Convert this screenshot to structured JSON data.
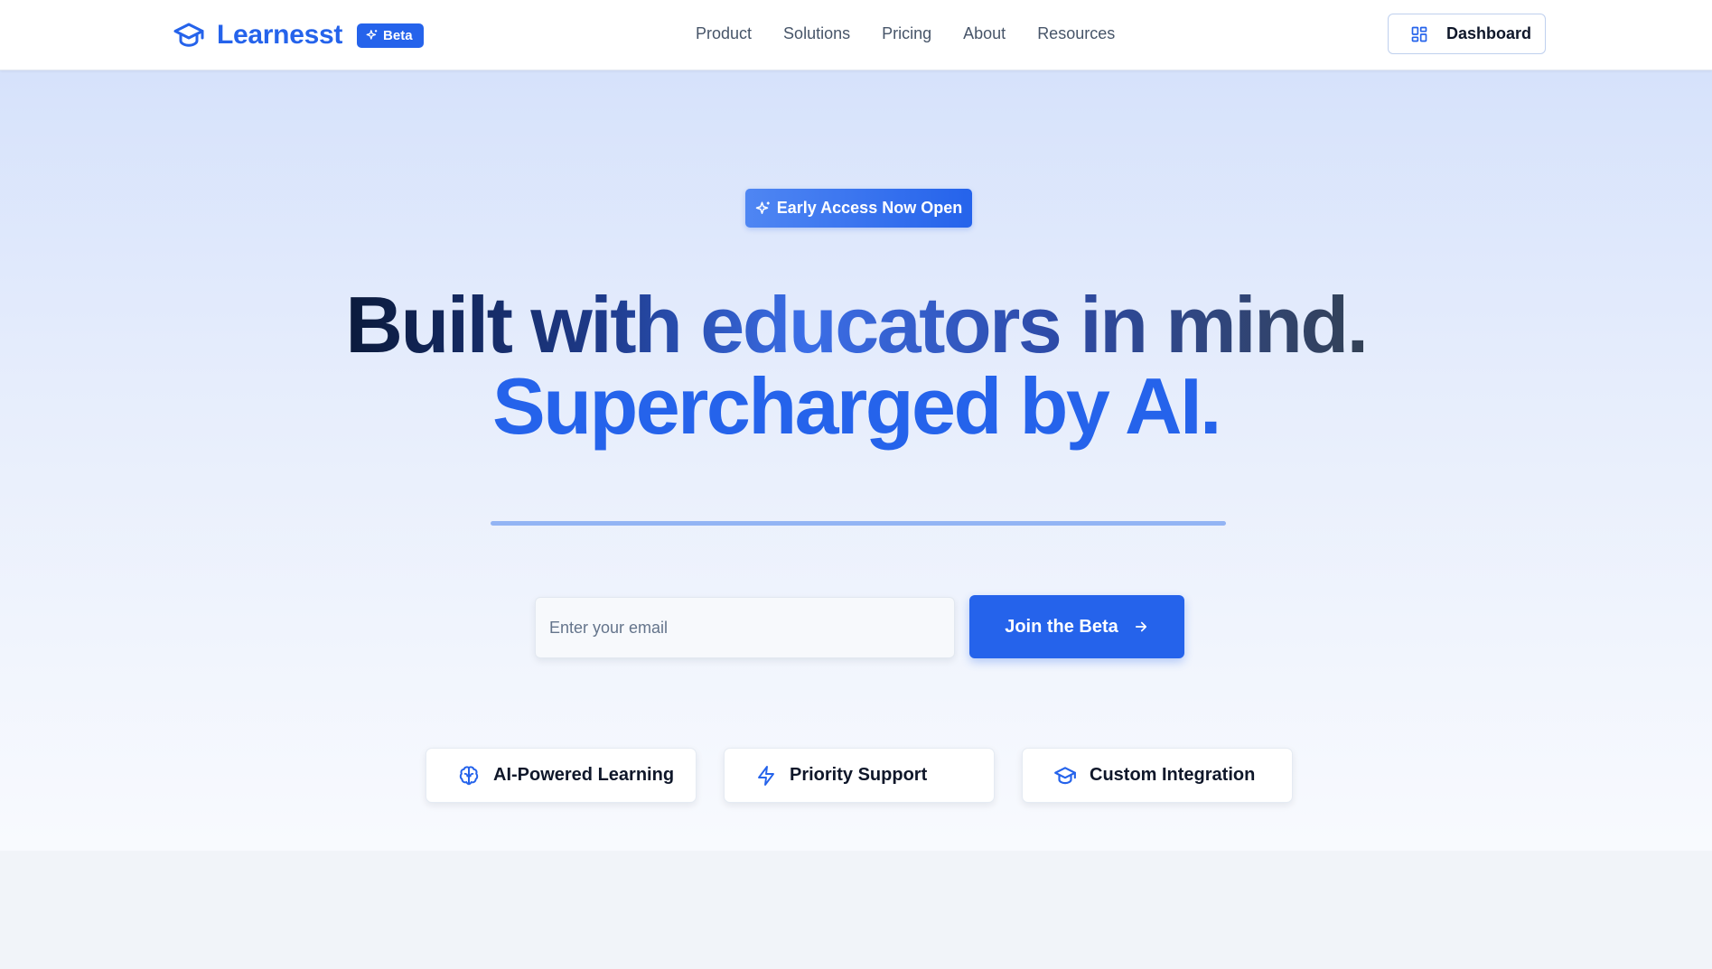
{
  "nav": {
    "brand_name": "Learnesst",
    "beta_label": "Beta",
    "links": [
      {
        "label": "Product"
      },
      {
        "label": "Solutions"
      },
      {
        "label": "Pricing"
      },
      {
        "label": "About"
      },
      {
        "label": "Resources"
      }
    ],
    "dashboard_label": "Dashboard"
  },
  "hero": {
    "badge_label": "Early Access Now Open",
    "headline_line1": "Built with educators in mind.",
    "headline_line2": "Supercharged by AI.",
    "email_placeholder": "Enter your email",
    "email_value": "",
    "cta_label": "Join the Beta"
  },
  "features": [
    {
      "label": "AI-Powered Learning",
      "icon": "brain-icon"
    },
    {
      "label": "Priority Support",
      "icon": "lightning-icon"
    },
    {
      "label": "Custom Integration",
      "icon": "graduation-cap-icon"
    }
  ],
  "colors": {
    "accent": "#2563eb",
    "dark_text": "#0f172a",
    "muted_text": "#475569",
    "underline": "#93b4f4"
  }
}
